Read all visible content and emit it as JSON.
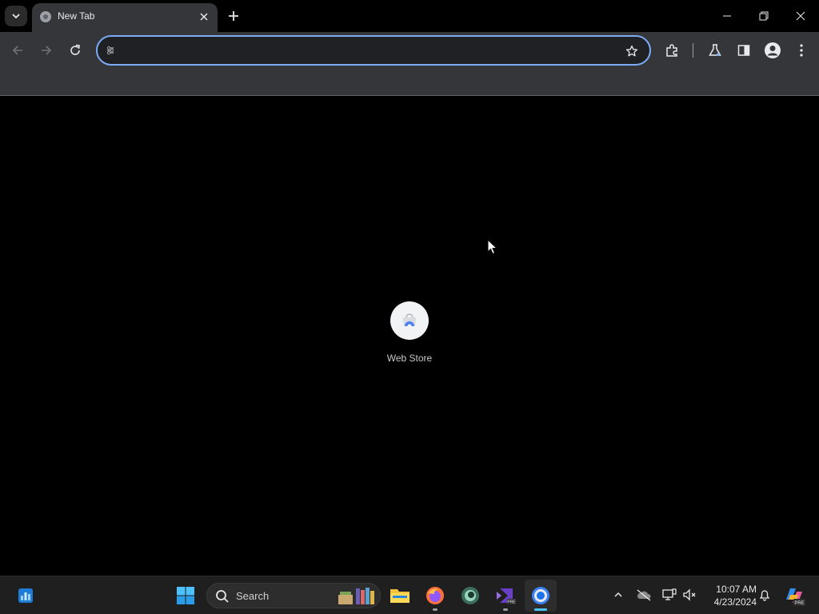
{
  "browser": {
    "tab": {
      "title": "New Tab"
    },
    "omnibox": {
      "value": "",
      "placeholder": ""
    }
  },
  "content": {
    "shortcuts": [
      {
        "label": "Web Store"
      }
    ]
  },
  "taskbar": {
    "search": {
      "label": "Search"
    },
    "clock": {
      "time": "10:07 AM",
      "date": "4/23/2024"
    },
    "apps": [
      {
        "icon": "windows-start-icon"
      },
      {
        "icon": "file-explorer-icon"
      },
      {
        "icon": "firefox-icon"
      },
      {
        "icon": "edge-canary-icon"
      },
      {
        "icon": "visual-studio-preview-icon"
      },
      {
        "icon": "chrome-icon",
        "active": true
      }
    ]
  },
  "colors": {
    "accent": "#7cacf8",
    "toolbar_bg": "#35363a",
    "taskbar_bg": "#1f1f1f",
    "active_indicator": "#4cc2ff"
  }
}
